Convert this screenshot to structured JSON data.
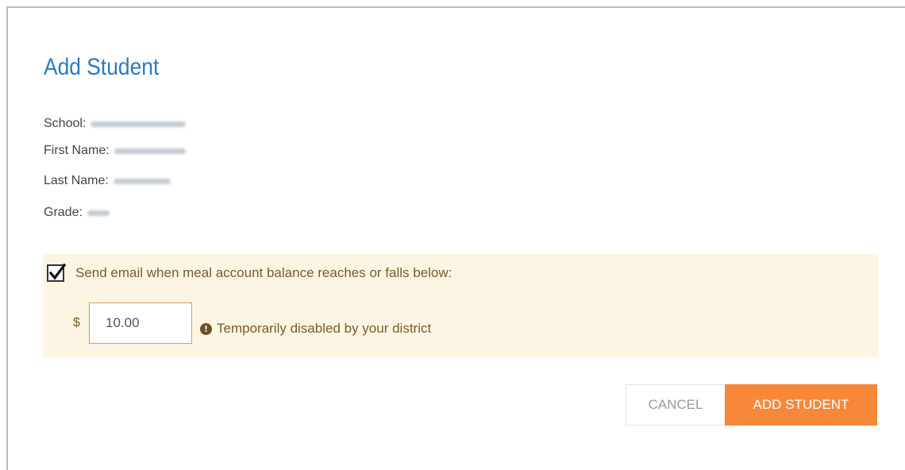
{
  "dialog": {
    "title": "Add Student"
  },
  "student_info": [
    {
      "label": "School:",
      "value_blurred": true
    },
    {
      "label": "First Name:",
      "value_blurred": true
    },
    {
      "label": "Last Name:",
      "value_blurred": true
    },
    {
      "label": "Grade:",
      "value_blurred": true
    }
  ],
  "low_balance_alert": {
    "checked": true,
    "checkbox_label": "Send email when meal account balance reaches or falls below:",
    "currency_symbol": "$",
    "amount_value": "10.00",
    "notice_icon": "exclamation-circle-icon",
    "notice_text": "Temporarily disabled by your district"
  },
  "buttons": {
    "cancel_label": "CANCEL",
    "add_label": "ADD STUDENT"
  },
  "colors": {
    "title": "#2c7bbf",
    "alert_background": "#fcf5e3",
    "alert_text": "#7a5b2c",
    "primary_button": "#f7883a"
  }
}
